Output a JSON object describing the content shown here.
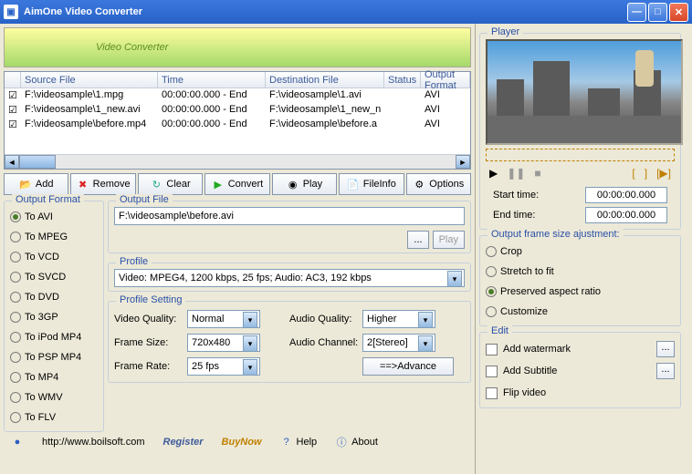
{
  "window": {
    "title": "AimOne Video Converter"
  },
  "banner": "Video Converter",
  "columns": {
    "c0": "",
    "c1": "Source File",
    "c2": "Time",
    "c3": "Destination File",
    "c4": "Status",
    "c5": "Output Format"
  },
  "rows": [
    {
      "src": "F:\\videosample\\1.mpg",
      "time": "00:00:00.000 - End",
      "dest": "F:\\videosample\\1.avi",
      "status": "",
      "fmt": "AVI"
    },
    {
      "src": "F:\\videosample\\1_new.avi",
      "time": "00:00:00.000 - End",
      "dest": "F:\\videosample\\1_new_n",
      "status": "",
      "fmt": "AVI"
    },
    {
      "src": "F:\\videosample\\before.mp4",
      "time": "00:00:00.000 - End",
      "dest": "F:\\videosample\\before.a",
      "status": "",
      "fmt": "AVI"
    }
  ],
  "toolbar": {
    "add": "Add",
    "remove": "Remove",
    "clear": "Clear",
    "convert": "Convert",
    "play": "Play",
    "fileinfo": "FileInfo",
    "options": "Options"
  },
  "outputFormat": {
    "legend": "Output Format",
    "items": [
      "To AVI",
      "To MPEG",
      "To VCD",
      "To SVCD",
      "To DVD",
      "To 3GP",
      "To iPod MP4",
      "To PSP MP4",
      "To MP4",
      "To WMV",
      "To FLV"
    ],
    "selected": 0
  },
  "outputFile": {
    "legend": "Output File",
    "value": "F:\\videosample\\before.avi",
    "browse": "...",
    "play": "Play"
  },
  "profile": {
    "legend": "Profile",
    "value": "Video: MPEG4, 1200 kbps, 25 fps;  Audio: AC3, 192 kbps"
  },
  "profileSetting": {
    "legend": "Profile Setting",
    "videoQualityLbl": "Video Quality:",
    "videoQuality": "Normal",
    "frameSizeLbl": "Frame Size:",
    "frameSize": "720x480",
    "frameRateLbl": "Frame Rate:",
    "frameRate": "25 fps",
    "audioQualityLbl": "Audio Quality:",
    "audioQuality": "Higher",
    "audioChannelLbl": "Audio Channel:",
    "audioChannel": "2[Stereo]",
    "advance": "==>Advance"
  },
  "footer": {
    "url": "http://www.boilsoft.com",
    "register": "Register",
    "buynow": "BuyNow",
    "help": "Help",
    "about": "About"
  },
  "player": {
    "legend": "Player",
    "startLbl": "Start time:",
    "start": "00:00:00.000",
    "endLbl": "End  time:",
    "end": "00:00:00.000"
  },
  "frameAdjust": {
    "legend": "Output frame size ajustment:",
    "items": [
      "Crop",
      "Stretch to fit",
      "Preserved aspect ratio",
      "Customize"
    ],
    "selected": 2
  },
  "edit": {
    "legend": "Edit",
    "watermark": "Add watermark",
    "subtitle": "Add Subtitle",
    "flip": "Flip video"
  }
}
